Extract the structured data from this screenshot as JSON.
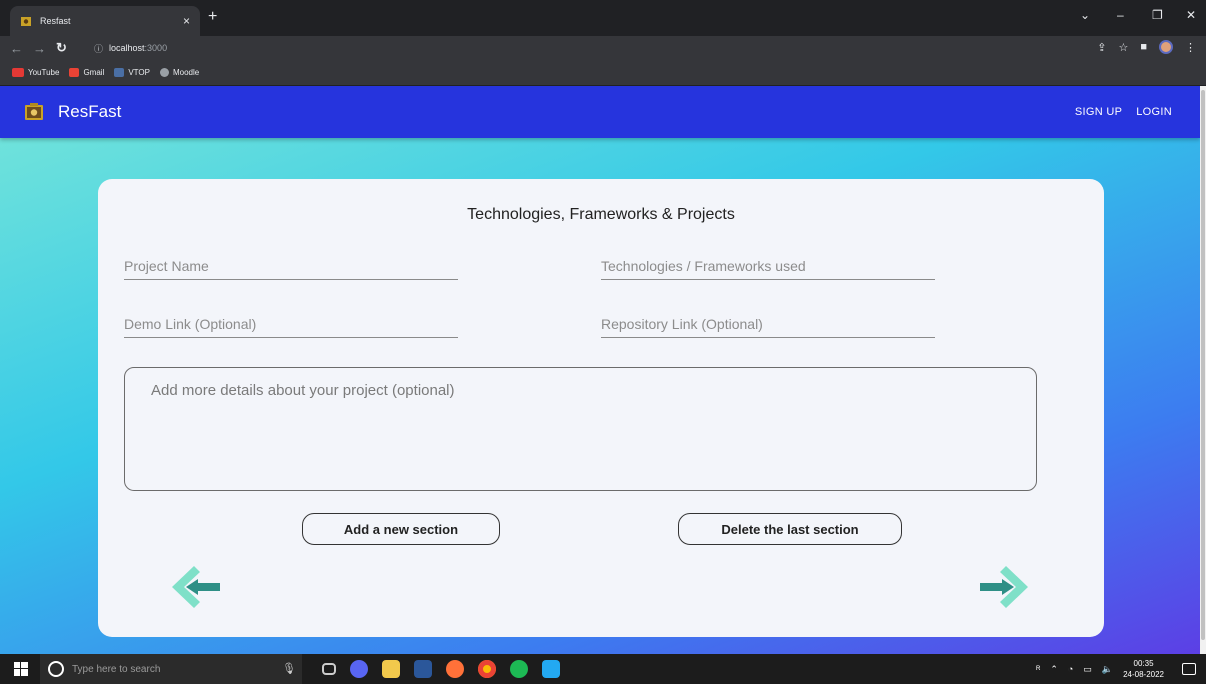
{
  "browser": {
    "tab_title": "Resfast",
    "tab_close": "×",
    "new_tab": "+",
    "url_host": "localhost",
    "url_port": ":3000",
    "bookmarks": [
      {
        "label": "YouTube",
        "color": "#e53935"
      },
      {
        "label": "Gmail",
        "color": "#ea4335"
      },
      {
        "label": "VTOP",
        "color": "#4a6fa5"
      },
      {
        "label": "Moodle",
        "color": "#9aa0a6"
      }
    ]
  },
  "app": {
    "brand": "ResFast",
    "nav": {
      "signup": "SIGN UP",
      "login": "LOGIN"
    },
    "section_title": "Technologies, Frameworks & Projects",
    "fields": {
      "project_name": "Project Name",
      "technologies": "Technologies / Frameworks used",
      "demo_link": "Demo Link (Optional)",
      "repo_link": "Repository Link (Optional)",
      "details": "Add more details about your project (optional)"
    },
    "buttons": {
      "add_section": "Add a new section",
      "delete_section": "Delete the last section"
    },
    "colors": {
      "appbar": "#2634dd",
      "arrow_light": "#7fe0c8",
      "arrow_dark": "#2e8f86"
    }
  },
  "taskbar": {
    "search_placeholder": "Type here to search",
    "time": "00:35",
    "date": "24-08-2022"
  }
}
